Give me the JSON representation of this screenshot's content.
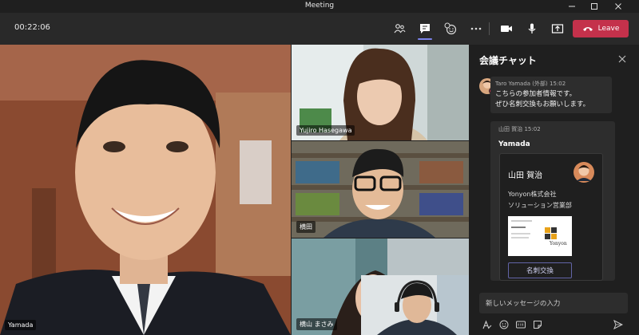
{
  "window": {
    "title": "Meeting"
  },
  "toolbar": {
    "timer": "00:22:06",
    "leave_label": "Leave"
  },
  "participants": [
    {
      "name": "Yamada"
    },
    {
      "name": "Yujiro Hasegawa"
    },
    {
      "name": "横田"
    },
    {
      "name": "横山 まさみ"
    }
  ],
  "chat": {
    "title": "会議チャット",
    "message1": {
      "sender": "Taro Yamada (外部)",
      "time": "15:02",
      "lines": [
        "こちらの参加者情報です。",
        "ぜひ名刺交換もお願いします。"
      ]
    },
    "message2": {
      "sender": "山田 賀治",
      "time": "15:02",
      "heading": "Yamada",
      "card": {
        "name": "山田 賀治",
        "company": "Yonyon株式会社",
        "department": "ソリューション営業部",
        "logo_text": "Yonyon",
        "button_label": "名刺交換"
      }
    },
    "compose_placeholder": "新しいメッセージの入力"
  },
  "colors": {
    "leave": "#c4314b",
    "accent": "#6264a7",
    "active": "#7b83eb"
  }
}
